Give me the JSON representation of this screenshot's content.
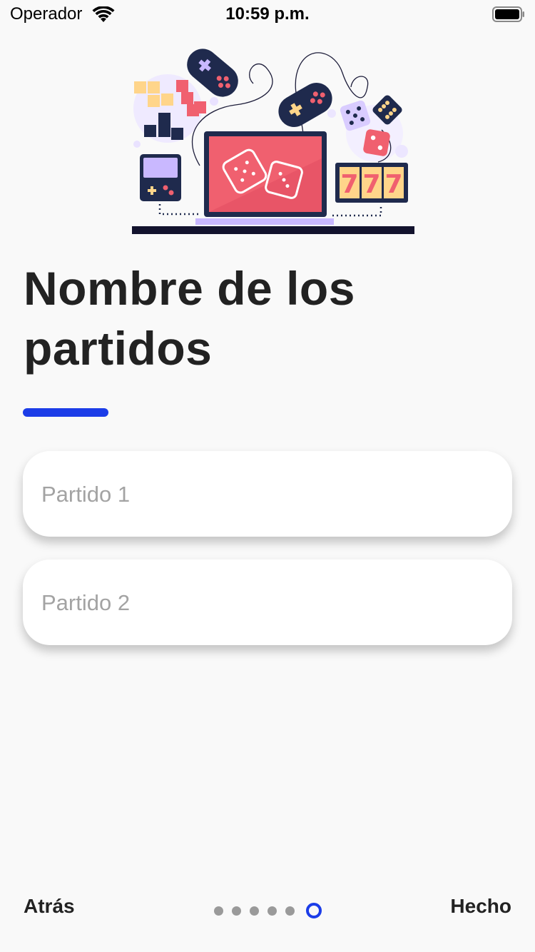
{
  "status_bar": {
    "carrier": "Operador",
    "time": "10:59 p.m.",
    "icons": [
      "wifi-icon",
      "battery-icon"
    ]
  },
  "illustration": {
    "description_icon": "gaming-illustration",
    "slot_digits": "777"
  },
  "main": {
    "title": "Nombre de los partidos",
    "accent_color": "#1c3de8",
    "inputs": [
      {
        "placeholder": "Partido 1",
        "value": ""
      },
      {
        "placeholder": "Partido 2",
        "value": ""
      }
    ]
  },
  "footer": {
    "back_label": "Atrás",
    "done_label": "Hecho",
    "page_count": 6,
    "current_page": 6
  }
}
